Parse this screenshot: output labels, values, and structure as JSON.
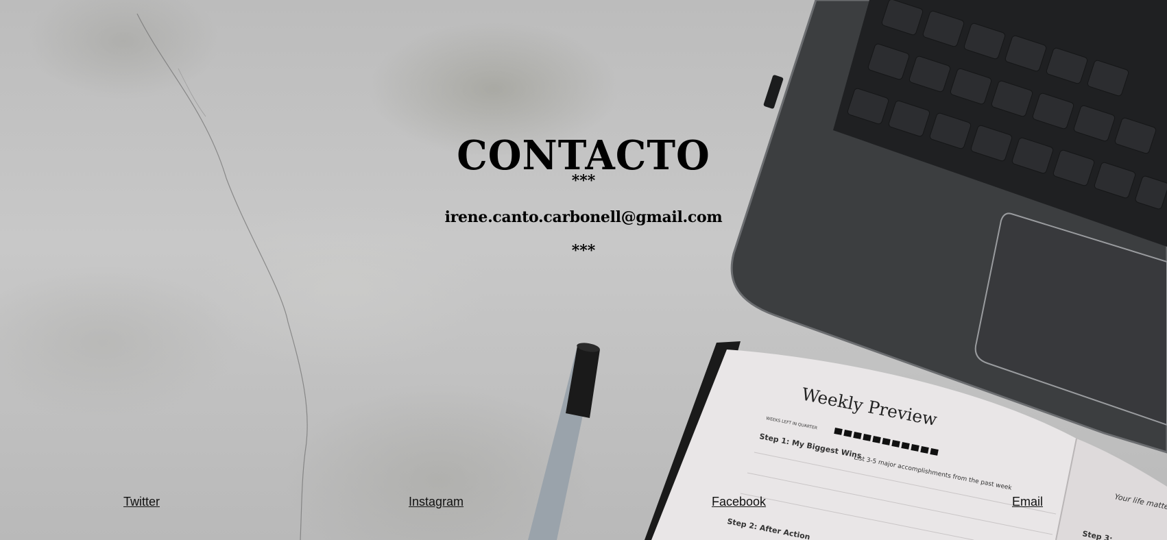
{
  "page": {
    "title": "CONTACTO",
    "separator_top": "***",
    "email": "irene.canto.carbonell@gmail.com",
    "separator_bottom": "***"
  },
  "photo": {
    "notebook_heading": "Weekly Preview",
    "notebook_weeks_label": "WEEKS LEFT IN QUARTER",
    "notebook_step1": "Step 1: My Biggest Wins",
    "notebook_step1_hint": "List 3-5 major accomplishments from the past week",
    "notebook_step2": "Step 2: After Action",
    "notebook_step3": "Step 3:",
    "notebook_right_page": "Your life matter"
  },
  "footer": {
    "links": [
      {
        "label": "Twitter",
        "icon": "twitter-link"
      },
      {
        "label": "Instagram",
        "icon": "instagram-link"
      },
      {
        "label": "Facebook",
        "icon": "facebook-link"
      },
      {
        "label": "Email",
        "icon": "email-link"
      }
    ]
  },
  "colors": {
    "text": "#000000",
    "concrete": "#bdbdbd",
    "laptop": "#3b3d3f"
  }
}
